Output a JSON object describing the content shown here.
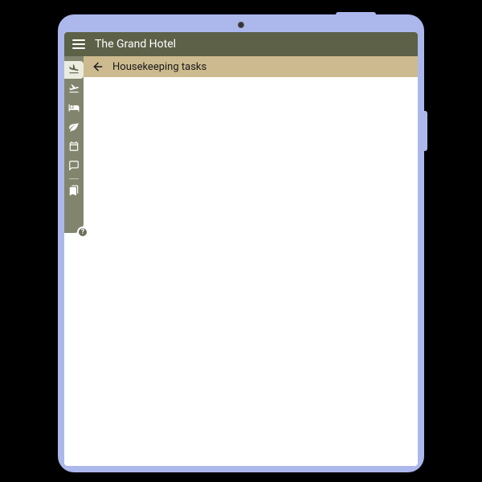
{
  "topbar": {
    "title": "The Grand Hotel"
  },
  "subheader": {
    "title": "Housekeeping tasks"
  },
  "help": {
    "badge": "?"
  }
}
